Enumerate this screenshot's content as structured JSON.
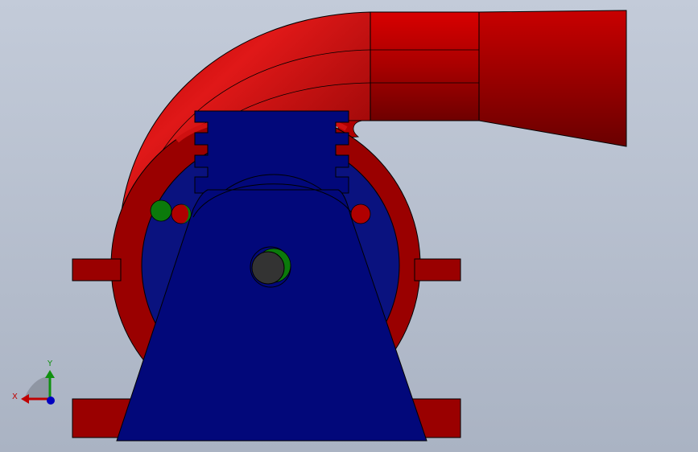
{
  "viewport": {
    "background_top": "#c3cbd9",
    "background_bottom": "#aab3c3"
  },
  "model": {
    "housing_color": "#9a0000",
    "housing_highlight": "#c40000",
    "base_color": "#02087a",
    "hub_color": "#333333",
    "pin_color": "#0b7a0b",
    "edge_color": "#000000"
  },
  "triad": {
    "x_label": "X",
    "y_label": "Y",
    "x_color": "#c00000",
    "y_color": "#109010",
    "z_color": "#0000c0"
  }
}
